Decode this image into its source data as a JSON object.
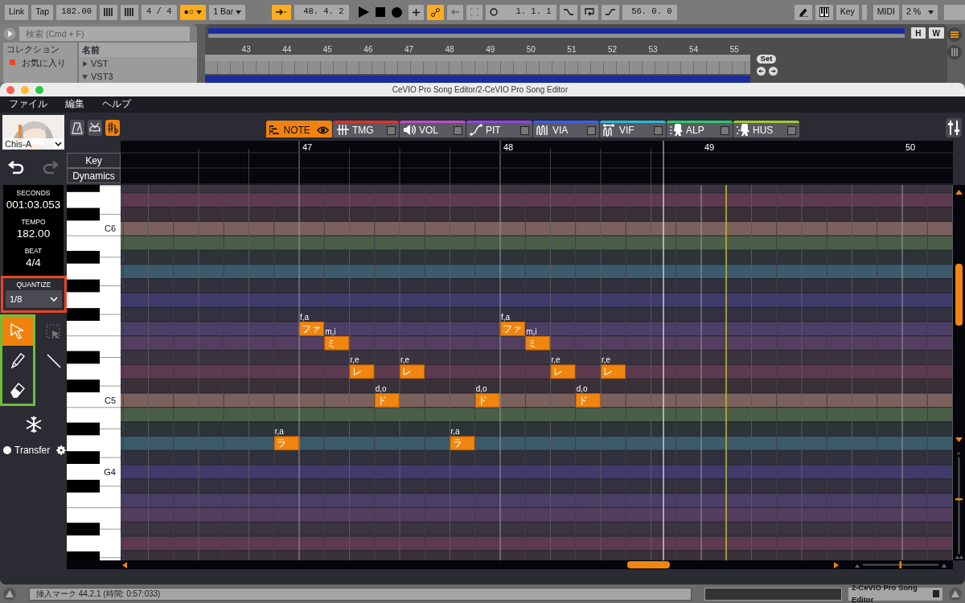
{
  "host": {
    "tempo_buttons": [
      "Link",
      "Tap"
    ],
    "tempo": "182.00",
    "signature": "4 / 4",
    "count_in": {
      "label": "●○",
      "on": true
    },
    "bar_menu": "1 Bar",
    "follow": {
      "on": true
    },
    "position": "48.  4.  2",
    "draw_mode": {
      "on": true
    },
    "loop_start": "1.  1.  1",
    "loop_length": "56.  0.  0",
    "key_button": "Key",
    "midi_button": "MIDI",
    "zoom_menu": "2 %",
    "browser": {
      "search_placeholder": "検索 (Cmd + F)",
      "collections_header": "コレクション",
      "collection": "お気に入り",
      "name_header": "名前",
      "items": [
        {
          "label": "VST",
          "expanded": false
        },
        {
          "label": "VST3",
          "expanded": true
        }
      ]
    },
    "ruler": [
      "43",
      "44",
      "45",
      "46",
      "47",
      "48",
      "49",
      "50",
      "51",
      "52",
      "53",
      "54",
      "55"
    ],
    "set_button": "Set",
    "view_buttons": [
      "H",
      "W"
    ],
    "status": "挿入マーク 44.2.1 (時間: 0:57:033)",
    "device_title": "2-CeVIO Pro Song Editor"
  },
  "window": {
    "title": "CeVIO Pro Song Editor/2-CeVIO Pro Song Editor"
  },
  "menu": [
    "ファイル",
    "編集",
    "ヘルプ"
  ],
  "singer": {
    "name": "Chis-A"
  },
  "toolbar_toggles": [
    {
      "kind": "metronome",
      "selected": false
    },
    {
      "kind": "drum",
      "selected": false
    },
    {
      "kind": "accidental",
      "selected": true
    }
  ],
  "info": {
    "seconds_label": "SECONDS",
    "seconds": "001:03.053",
    "tempo_label": "TEMPO",
    "tempo": "182.00",
    "beat_label": "BEAT",
    "beat": "4/4"
  },
  "quantize": {
    "label": "QUANTIZE",
    "value": "1/8"
  },
  "tools": [
    {
      "kind": "select",
      "selected": true
    },
    {
      "kind": "pencil",
      "selected": false
    },
    {
      "kind": "eraser",
      "selected": false
    }
  ],
  "side_tools": [
    {
      "kind": "marquee",
      "selected": false
    },
    {
      "kind": "line",
      "selected": false
    }
  ],
  "transfer": {
    "label": "Transfer"
  },
  "tabs": [
    {
      "label": "NOTE",
      "kind": "note",
      "color": "#f0820f",
      "selected": true
    },
    {
      "label": "TMG",
      "kind": "timing",
      "color": "#e0302c",
      "selected": false,
      "checked": false
    },
    {
      "label": "VOL",
      "kind": "volume",
      "color": "#c04cc8",
      "selected": false,
      "checked": false
    },
    {
      "label": "PIT",
      "kind": "pitch",
      "color": "#8a46e8",
      "selected": false,
      "checked": false
    },
    {
      "label": "VIA",
      "kind": "vibrato",
      "color": "#3a5cf0",
      "selected": false,
      "checked": false
    },
    {
      "label": "VIF",
      "kind": "vibfreq",
      "color": "#2cb8d8",
      "selected": false,
      "checked": false
    },
    {
      "label": "ALP",
      "kind": "alpha",
      "color": "#2cc870",
      "selected": false,
      "checked": false
    },
    {
      "label": "HUS",
      "kind": "husky",
      "color": "#9ccc30",
      "selected": false,
      "checked": false
    }
  ],
  "header_rows": [
    "Key",
    "Dynamics"
  ],
  "bars": [
    "47",
    "48",
    "49",
    "50"
  ],
  "key_labels": [
    {
      "label": "C6"
    },
    {
      "label": "C5"
    },
    {
      "label": "G4"
    }
  ],
  "vertical_zoom": {
    "level": 0.58
  },
  "horizontal_zoom": {
    "level": 0.5
  },
  "notes": [
    {
      "phonemes": "r,a",
      "lyric": "ラ"
    },
    {
      "phonemes": "f,a",
      "lyric": "ファ"
    },
    {
      "phonemes": "m,i",
      "lyric": "ミ"
    },
    {
      "phonemes": "r,e",
      "lyric": "レ"
    },
    {
      "phonemes": "d,o",
      "lyric": "ド"
    },
    {
      "phonemes": "r,e",
      "lyric": "レ"
    },
    {
      "phonemes": "r,a",
      "lyric": "ラ"
    },
    {
      "phonemes": "d,o",
      "lyric": "ド"
    },
    {
      "phonemes": "f,a",
      "lyric": "ファ"
    },
    {
      "phonemes": "m,i",
      "lyric": "ミ"
    },
    {
      "phonemes": "r,e",
      "lyric": "レ"
    },
    {
      "phonemes": "d,o",
      "lyric": "ド"
    },
    {
      "phonemes": "r,e",
      "lyric": "レ"
    }
  ]
}
